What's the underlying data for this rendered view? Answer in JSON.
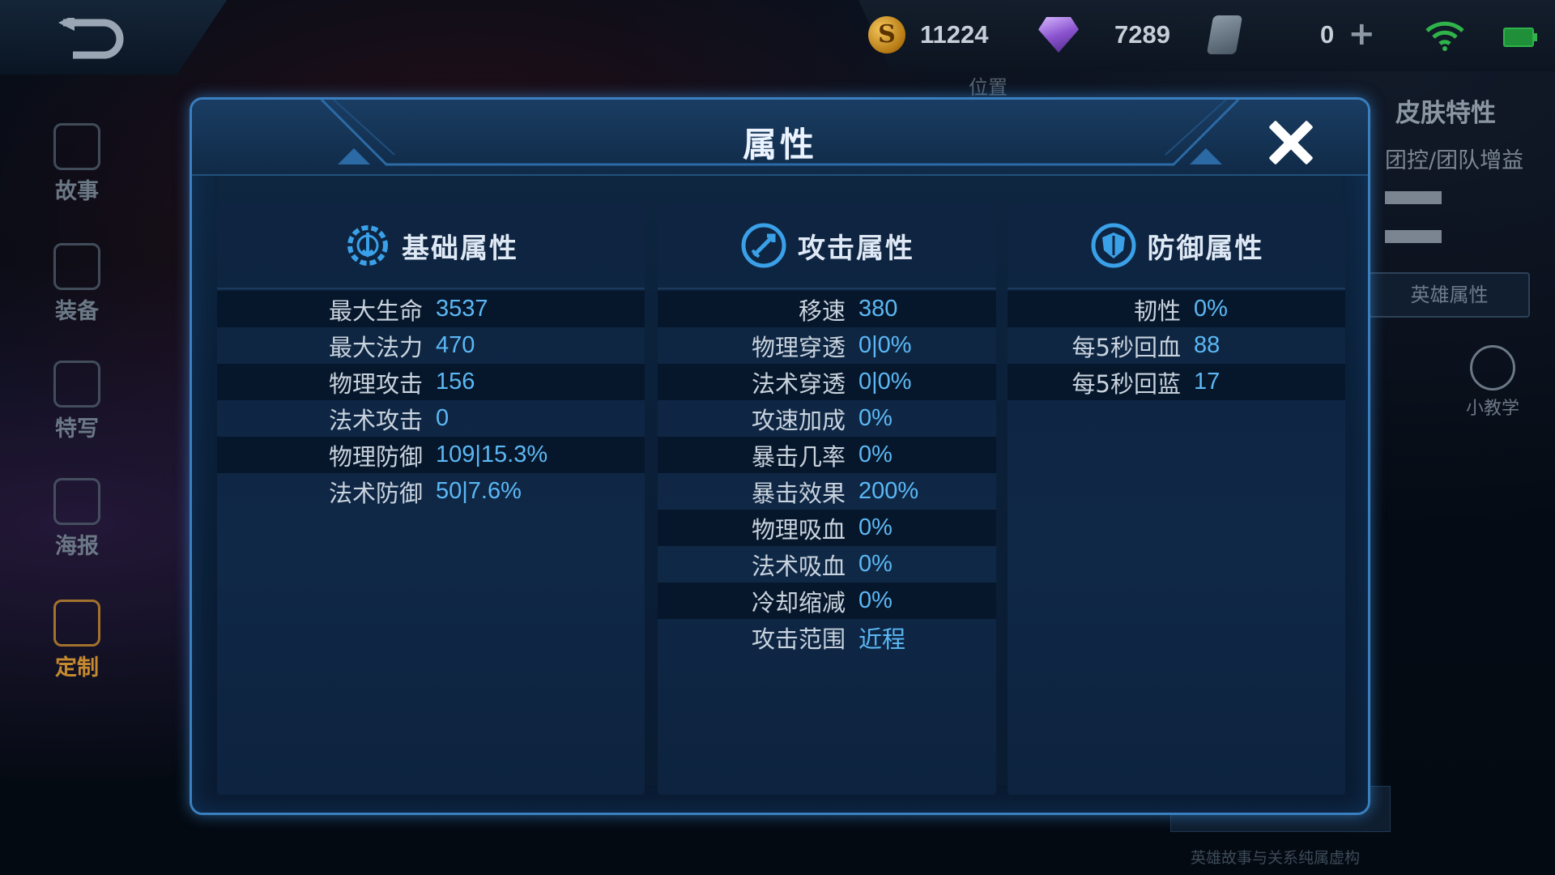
{
  "topbar": {
    "gold": "11224",
    "diamonds": "7289",
    "tickets": "0",
    "gold_icon_symbol": "S"
  },
  "left_nav": [
    {
      "label": "故事",
      "icon": "book-icon"
    },
    {
      "label": "装备",
      "icon": "armor-icon"
    },
    {
      "label": "特写",
      "icon": "closeup-icon"
    },
    {
      "label": "海报",
      "icon": "poster-icon"
    },
    {
      "label": "定制",
      "icon": "customize-icon"
    }
  ],
  "background_panel": {
    "position_tab": "位置",
    "skin_features_title": "皮肤特性",
    "role_tags": "团控/团队增益",
    "hero_attributes_button": "英雄属性",
    "tutorial_label": "小教学",
    "footnote": "英雄故事与关系纯属虚构"
  },
  "modal": {
    "title": "属性",
    "basic": {
      "title": "基础属性",
      "rows": [
        {
          "k": "最大生命",
          "v": "3537"
        },
        {
          "k": "最大法力",
          "v": "470"
        },
        {
          "k": "物理攻击",
          "v": "156"
        },
        {
          "k": "法术攻击",
          "v": "0"
        },
        {
          "k": "物理防御",
          "v": "109|15.3%"
        },
        {
          "k": "法术防御",
          "v": "50|7.6%"
        }
      ]
    },
    "attack": {
      "title": "攻击属性",
      "rows": [
        {
          "k": "移速",
          "v": "380"
        },
        {
          "k": "物理穿透",
          "v": "0|0%"
        },
        {
          "k": "法术穿透",
          "v": "0|0%"
        },
        {
          "k": "攻速加成",
          "v": "0%"
        },
        {
          "k": "暴击几率",
          "v": "0%"
        },
        {
          "k": "暴击效果",
          "v": "200%"
        },
        {
          "k": "物理吸血",
          "v": "0%"
        },
        {
          "k": "法术吸血",
          "v": "0%"
        },
        {
          "k": "冷却缩减",
          "v": "0%"
        },
        {
          "k": "攻击范围",
          "v": "近程"
        }
      ]
    },
    "defense": {
      "title": "防御属性",
      "rows": [
        {
          "k": "韧性",
          "v": "0%"
        },
        {
          "k": "每5秒回血",
          "v": "88"
        },
        {
          "k": "每5秒回蓝",
          "v": "17"
        }
      ]
    }
  },
  "colors": {
    "accent_blue": "#5bb8f5",
    "modal_border": "#3a7fbf",
    "label_text": "#c9d3de"
  }
}
